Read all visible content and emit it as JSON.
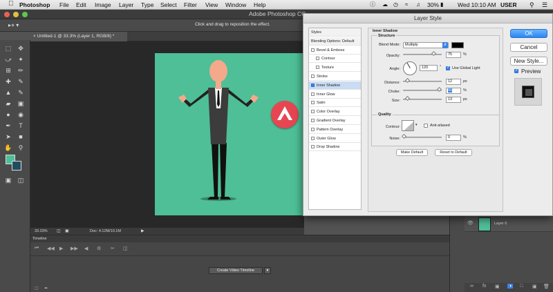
{
  "menubar": {
    "app": "Photoshop",
    "items": [
      "File",
      "Edit",
      "Image",
      "Layer",
      "Type",
      "Select",
      "Filter",
      "View",
      "Window",
      "Help"
    ],
    "battery": "30%",
    "clock": "Wed 10:10 AM",
    "user": "USER"
  },
  "window": {
    "title": "Adobe Photoshop CC"
  },
  "options_bar": {
    "hint": "Click and drag to reposition the effect."
  },
  "document": {
    "tab": "Untitled-1 @ 33.3% (Layer 1, RGB/8) *",
    "zoom": "33.33%",
    "doc_size": "Doc: 4.12M/10.1M",
    "background_color": "#4ebf97"
  },
  "timeline": {
    "title": "Timeline",
    "create_button": "Create Video Timeline"
  },
  "layers": {
    "layer_name": "Layer 0"
  },
  "dialog": {
    "title": "Layer Style",
    "styles_list": [
      {
        "label": "Styles",
        "checkbox": false,
        "selected": false,
        "indent": false
      },
      {
        "label": "Blending Options: Default",
        "checkbox": false,
        "selected": false,
        "indent": false
      },
      {
        "label": "Bevel & Emboss",
        "checkbox": true,
        "checked": false,
        "selected": false,
        "indent": false
      },
      {
        "label": "Contour",
        "checkbox": true,
        "checked": false,
        "selected": false,
        "indent": true
      },
      {
        "label": "Texture",
        "checkbox": true,
        "checked": false,
        "selected": false,
        "indent": true
      },
      {
        "label": "Stroke",
        "checkbox": true,
        "checked": false,
        "selected": false,
        "indent": false
      },
      {
        "label": "Inner Shadow",
        "checkbox": true,
        "checked": true,
        "selected": true,
        "indent": false
      },
      {
        "label": "Inner Glow",
        "checkbox": true,
        "checked": false,
        "selected": false,
        "indent": false
      },
      {
        "label": "Satin",
        "checkbox": true,
        "checked": false,
        "selected": false,
        "indent": false
      },
      {
        "label": "Color Overlay",
        "checkbox": true,
        "checked": false,
        "selected": false,
        "indent": false
      },
      {
        "label": "Gradient Overlay",
        "checkbox": true,
        "checked": false,
        "selected": false,
        "indent": false
      },
      {
        "label": "Pattern Overlay",
        "checkbox": true,
        "checked": false,
        "selected": false,
        "indent": false
      },
      {
        "label": "Outer Glow",
        "checkbox": true,
        "checked": false,
        "selected": false,
        "indent": false
      },
      {
        "label": "Drop Shadow",
        "checkbox": true,
        "checked": false,
        "selected": false,
        "indent": false
      }
    ],
    "section_title": "Inner Shadow",
    "structure": {
      "title": "Structure",
      "blend_mode_label": "Blend Mode:",
      "blend_mode": "Multiply",
      "shadow_color": "#000000",
      "opacity_label": "Opacity:",
      "opacity": "75",
      "angle_label": "Angle:",
      "angle": "120",
      "angle_unit": "°",
      "use_global_light": "Use Global Light",
      "use_global_light_checked": true,
      "distance_label": "Distance:",
      "distance": "12",
      "choke_label": "Choke:",
      "choke": "91",
      "size_label": "Size:",
      "size": "13",
      "percent": "%",
      "px": "px"
    },
    "quality": {
      "title": "Quality",
      "contour_label": "Contour:",
      "anti_aliased": "Anti-aliased",
      "noise_label": "Noise:",
      "noise": "0"
    },
    "make_default": "Make Default",
    "reset_default": "Reset to Default",
    "ok": "OK",
    "cancel": "Cancel",
    "new_style": "New Style...",
    "preview": "Preview",
    "preview_checked": true
  }
}
